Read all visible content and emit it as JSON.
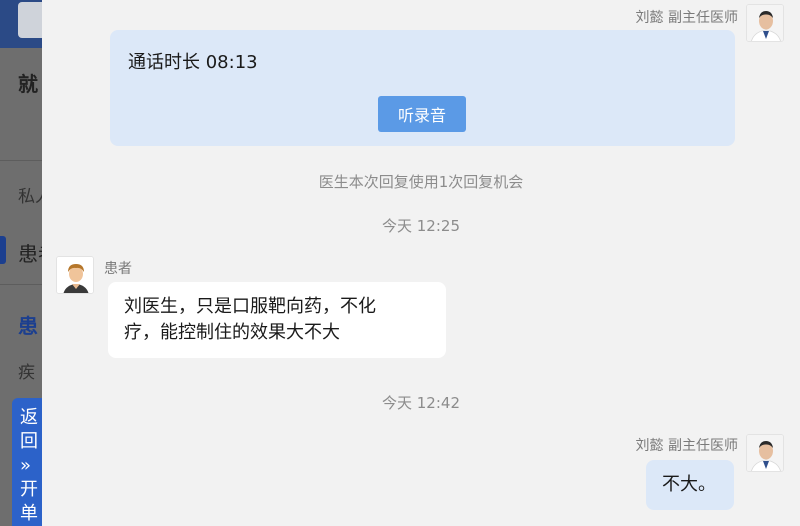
{
  "background_page": {
    "item_1": "就",
    "item_2": "私人",
    "item_3": "患者",
    "item_4": "患",
    "item_5": "疾",
    "float_button": [
      "返",
      "回",
      "»",
      "开",
      "单"
    ]
  },
  "messages": {
    "call_card": {
      "sender": "刘懿 副主任医师",
      "duration_text": "通话时长 08:13",
      "button_label": "听录音"
    },
    "system_note": "医生本次回复使用1次回复机会",
    "timestamp_1": "今天 12:25",
    "patient_message": {
      "sender": "患者",
      "line_1": "刘医生，只是口服靶向药，不化",
      "line_2": "疗，能控制住的效果大不大"
    },
    "timestamp_2": "今天 12:42",
    "doctor_message": {
      "sender": "刘懿 副主任医师",
      "text": "不大。"
    }
  }
}
